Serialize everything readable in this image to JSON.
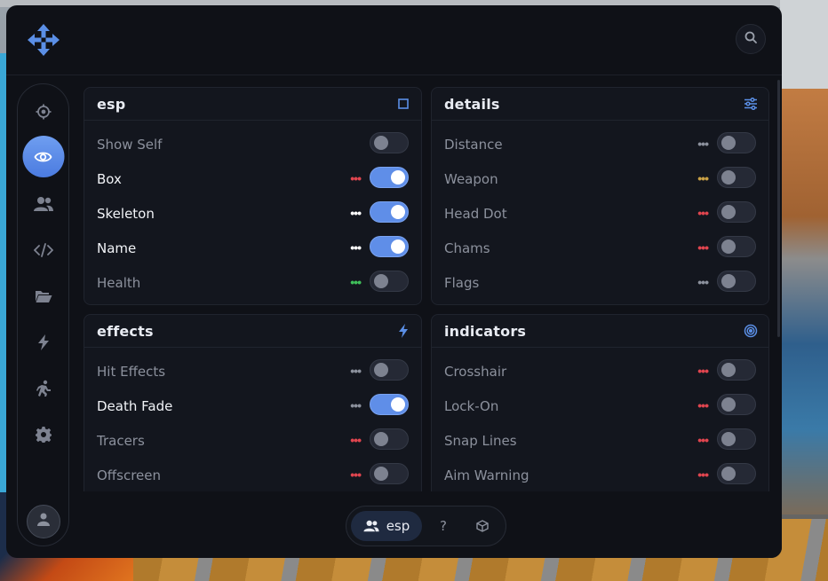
{
  "colors": {
    "accent": "#5f8ee8",
    "red_dots": "#e0454f",
    "white_dots": "#ffffff",
    "green_dots": "#3fbf5a",
    "gray_dots": "#8c919d",
    "amber_dots": "#c9a045"
  },
  "header": {
    "logo_icon": "move-arrows-icon",
    "search_icon": "search-icon"
  },
  "sidebar": {
    "items": [
      {
        "icon": "crosshair-icon",
        "active": false
      },
      {
        "icon": "eye-icon",
        "active": true
      },
      {
        "icon": "users-icon",
        "active": false
      },
      {
        "icon": "code-icon",
        "active": false
      },
      {
        "icon": "folder-open-icon",
        "active": false
      },
      {
        "icon": "bolt-icon",
        "active": false
      },
      {
        "icon": "running-icon",
        "active": false
      },
      {
        "icon": "gear-icon",
        "active": false
      }
    ],
    "avatar_icon": "user-icon"
  },
  "panels": {
    "esp": {
      "title": "esp",
      "icon": "square-icon",
      "rows": [
        {
          "label": "Show Self",
          "on": false,
          "dots": null
        },
        {
          "label": "Box",
          "on": true,
          "dots": "red"
        },
        {
          "label": "Skeleton",
          "on": true,
          "dots": "white"
        },
        {
          "label": "Name",
          "on": true,
          "dots": "white"
        },
        {
          "label": "Health",
          "on": false,
          "dots": "green"
        }
      ]
    },
    "details": {
      "title": "details",
      "icon": "sliders-icon",
      "rows": [
        {
          "label": "Distance",
          "on": false,
          "dots": "gray"
        },
        {
          "label": "Weapon",
          "on": false,
          "dots": "amber"
        },
        {
          "label": "Head Dot",
          "on": false,
          "dots": "red"
        },
        {
          "label": "Chams",
          "on": false,
          "dots": "red"
        },
        {
          "label": "Flags",
          "on": false,
          "dots": "gray"
        }
      ]
    },
    "effects": {
      "title": "effects",
      "icon": "bolt-icon",
      "rows": [
        {
          "label": "Hit Effects",
          "on": false,
          "dots": "gray"
        },
        {
          "label": "Death Fade",
          "on": true,
          "dots": "gray"
        },
        {
          "label": "Tracers",
          "on": false,
          "dots": "red"
        },
        {
          "label": "Offscreen",
          "on": false,
          "dots": "red"
        }
      ]
    },
    "indicators": {
      "title": "indicators",
      "icon": "target-icon",
      "rows": [
        {
          "label": "Crosshair",
          "on": false,
          "dots": "red"
        },
        {
          "label": "Lock-On",
          "on": false,
          "dots": "red"
        },
        {
          "label": "Snap Lines",
          "on": false,
          "dots": "red"
        },
        {
          "label": "Aim Warning",
          "on": false,
          "dots": "red"
        }
      ]
    }
  },
  "bottom_tabs": {
    "active_label": "esp",
    "active_icon": "users-icon",
    "help_label": "?",
    "box_icon": "cube-icon"
  }
}
